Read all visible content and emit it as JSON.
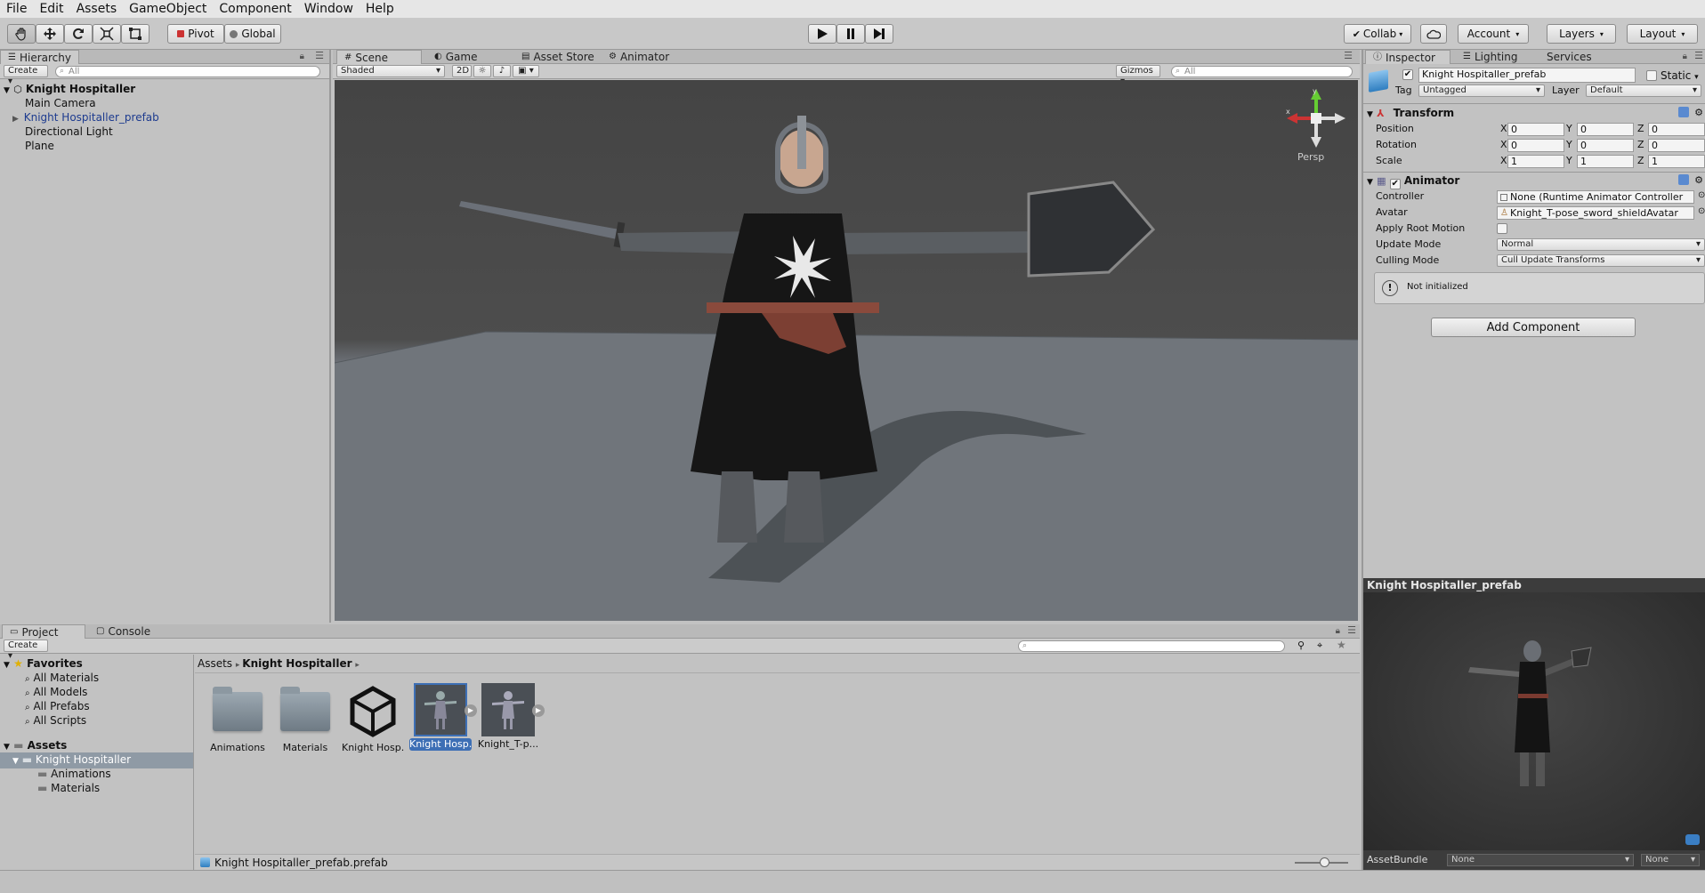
{
  "menu": [
    "File",
    "Edit",
    "Assets",
    "GameObject",
    "Component",
    "Window",
    "Help"
  ],
  "toolbar": {
    "pivot_label": "Pivot",
    "global_label": "Global",
    "collab_label": "Collab",
    "account_label": "Account",
    "layers_label": "Layers",
    "layout_label": "Layout"
  },
  "hierarchy": {
    "tab_label": "Hierarchy",
    "create_label": "Create",
    "search_placeholder": "All",
    "scene_name": "Knight Hospitaller",
    "items": [
      "Main Camera",
      "Knight Hospitaller_prefab",
      "Directional Light",
      "Plane"
    ],
    "prefab_color": "#1d3b8f"
  },
  "scene": {
    "tabs": [
      "Scene",
      "Game",
      "Asset Store",
      "Animator"
    ],
    "shading": "Shaded",
    "mode_2d": "2D",
    "gizmos_label": "Gizmos",
    "search_placeholder": "All",
    "persp_label": "Persp",
    "sky_color": "#4a4a4a",
    "ground_color": "#6d7278"
  },
  "inspector": {
    "tabs": [
      "Inspector",
      "Lighting",
      "Services"
    ],
    "object_name": "Knight Hospitaller_prefab",
    "static_label": "Static",
    "tag_label": "Tag",
    "tag_value": "Untagged",
    "layer_label": "Layer",
    "layer_value": "Default",
    "transform": {
      "title": "Transform",
      "position_label": "Position",
      "rotation_label": "Rotation",
      "scale_label": "Scale",
      "axis_x": "X",
      "axis_y": "Y",
      "axis_z": "Z",
      "position": [
        "0",
        "0",
        "0"
      ],
      "rotation": [
        "0",
        "0",
        "0"
      ],
      "scale": [
        "1",
        "1",
        "1"
      ]
    },
    "animator": {
      "title": "Animator",
      "controller_label": "Controller",
      "controller_value": "None (Runtime Animator Controller",
      "avatar_label": "Avatar",
      "avatar_value": "Knight_T-pose_sword_shieldAvatar",
      "apply_root_label": "Apply Root Motion",
      "update_mode_label": "Update Mode",
      "update_mode_value": "Normal",
      "culling_mode_label": "Culling Mode",
      "culling_mode_value": "Cull Update Transforms",
      "notice": "Not initialized"
    },
    "add_component": "Add Component",
    "preview_title": "Knight Hospitaller_prefab",
    "assetbundle_label": "AssetBundle",
    "assetbundle_value": "None",
    "assetbundle_variant": "None"
  },
  "project": {
    "tabs": [
      "Project",
      "Console"
    ],
    "create_label": "Create",
    "favorites_label": "Favorites",
    "favorites": [
      "All Materials",
      "All Models",
      "All Prefabs",
      "All Scripts"
    ],
    "assets_label": "Assets",
    "assets_tree": [
      "Knight Hospitaller",
      "Animations",
      "Materials"
    ],
    "breadcrumb": [
      "Assets",
      "Knight Hospitaller"
    ],
    "assets": [
      "Animations",
      "Materials",
      "Knight Hosp...",
      "Knight Hosp...",
      "Knight_T-p..."
    ],
    "status_file": "Knight Hospitaller_prefab.prefab"
  }
}
